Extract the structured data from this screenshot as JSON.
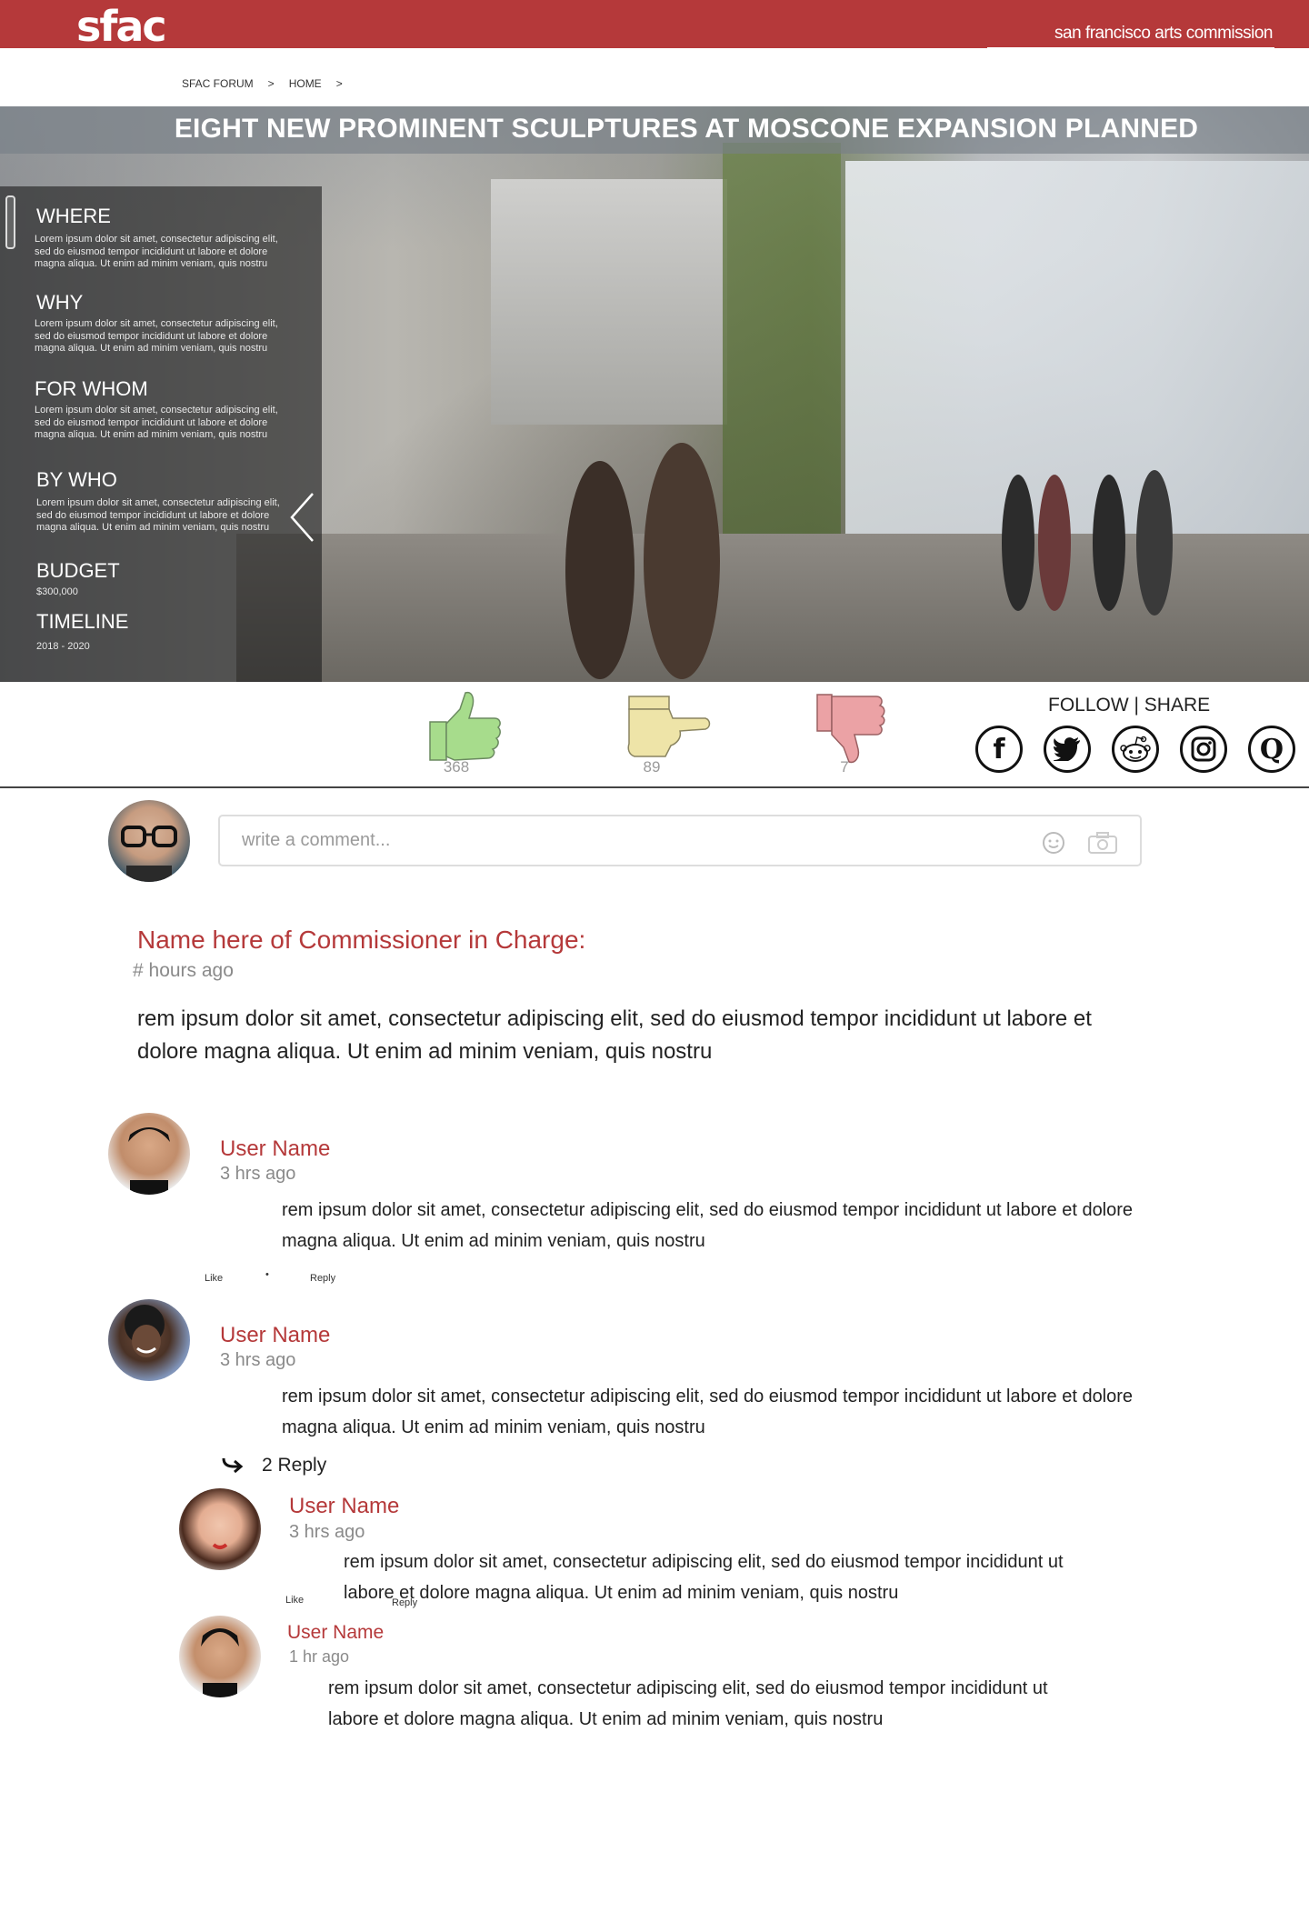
{
  "header": {
    "logo": "sfac",
    "tagline": "san francisco arts commission",
    "brand_color": "#b5393a"
  },
  "breadcrumb": [
    "SFAC FORUM",
    ">",
    "HOME",
    ">"
  ],
  "hero": {
    "title": "EIGHT NEW PROMINENT SCULPTURES AT MOSCONE EXPANSION PLANNED",
    "sections": [
      {
        "heading": "WHERE",
        "text": "Lorem ipsum dolor sit amet, consectetur adipiscing elit, sed do eiusmod tempor incididunt ut labore et dolore magna aliqua. Ut enim ad minim veniam, quis nostru"
      },
      {
        "heading": "WHY",
        "text": "Lorem ipsum dolor sit amet, consectetur adipiscing elit, sed do eiusmod tempor incididunt ut labore et dolore magna aliqua. Ut enim ad minim veniam, quis nostru"
      },
      {
        "heading": "FOR WHOM",
        "text": "Lorem ipsum dolor sit amet, consectetur adipiscing elit, sed do eiusmod tempor incididunt ut labore et dolore magna aliqua. Ut enim ad minim veniam, quis nostru"
      },
      {
        "heading": "BY WHO",
        "text": "Lorem ipsum dolor sit amet, consectetur adipiscing elit, sed do eiusmod tempor incididunt ut labore et dolore magna aliqua. Ut enim ad minim veniam, quis nostru"
      },
      {
        "heading": "BUDGET",
        "text": "$300,000"
      },
      {
        "heading": "TIMELINE",
        "text": "2018 - 2020"
      }
    ]
  },
  "reactions": {
    "like_count": "368",
    "neutral_count": "89",
    "dislike_count": "7",
    "like_color": "#a7dc8c",
    "neutral_color": "#eee4a8",
    "dislike_color": "#eba2a5"
  },
  "follow_share": {
    "label": "FOLLOW | SHARE",
    "icons": [
      "facebook-icon",
      "twitter-icon",
      "reddit-icon",
      "instagram-icon",
      "quora-icon"
    ]
  },
  "composer": {
    "placeholder": "write a comment..."
  },
  "commissioner": {
    "name": "Name here of Commissioner in Charge:",
    "time": "# hours ago",
    "text": "rem ipsum dolor sit amet, consectetur adipiscing elit, sed do eiusmod tempor incididunt ut labore et dolore magna aliqua. Ut enim ad minim veniam, quis nostru"
  },
  "comments": [
    {
      "name": "User Name",
      "time": "3 hrs ago",
      "text": "rem ipsum dolor sit amet, consectetur adipiscing elit, sed do eiusmod tempor incididunt ut labore et dolore magna aliqua. Ut enim ad minim veniam, quis nostru",
      "like": "Like",
      "dot": "•",
      "reply": "Reply"
    },
    {
      "name": "User Name",
      "time": "3 hrs ago",
      "text": "rem ipsum dolor sit amet, consectetur adipiscing elit, sed do eiusmod tempor incididunt ut labore et dolore magna aliqua. Ut enim ad minim veniam, quis nostru",
      "reply_count": "2 Reply"
    }
  ],
  "replies": [
    {
      "name": "User Name",
      "time": "3 hrs ago",
      "text": "rem ipsum dolor sit amet, consectetur adipiscing elit, sed do eiusmod tempor incididunt ut labore et dolore magna aliqua. Ut enim ad minim veniam, quis nostru",
      "like": "Like",
      "reply": "Reply"
    },
    {
      "name": "User Name",
      "time": "1 hr ago",
      "text": "rem ipsum dolor sit amet, consectetur adipiscing elit, sed do eiusmod tempor incididunt ut labore et dolore magna aliqua. Ut enim ad minim veniam, quis nostru"
    }
  ]
}
